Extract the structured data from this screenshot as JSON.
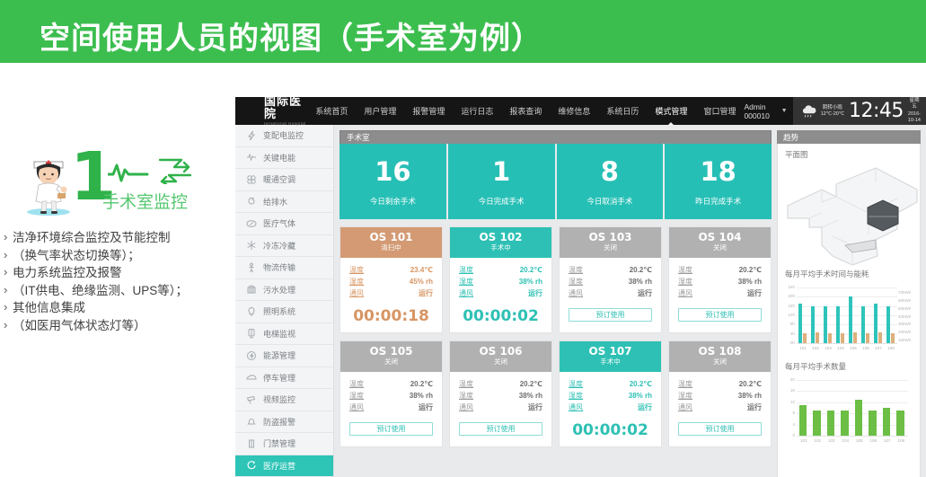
{
  "slide": {
    "title": "空间使用人员的视图（手术室为例）",
    "banner_color": "#3cbe4f",
    "number": "1",
    "subject_label": "手术室监控",
    "bullets": [
      "洁净环境综合监控及节能控制",
      "（换气率状态切换等）；",
      "电力系统监控及报警",
      "（IT供电、绝缘监测、UPS等）；",
      "其他信息集成",
      "（如医用气体状态灯等）"
    ]
  },
  "app": {
    "brand_cn": "国际医院",
    "brand_en": "Iernational Hospital",
    "nav": [
      {
        "label": "系统首页",
        "active": false
      },
      {
        "label": "用户管理",
        "active": false
      },
      {
        "label": "报警管理",
        "active": false
      },
      {
        "label": "运行日志",
        "active": false
      },
      {
        "label": "报表查询",
        "active": false
      },
      {
        "label": "维修信息",
        "active": false
      },
      {
        "label": "系统日历",
        "active": false
      },
      {
        "label": "模式管理",
        "active": true
      },
      {
        "label": "窗口管理",
        "active": false
      }
    ],
    "admin": "Admin 000010",
    "weather": {
      "condition": "阴转小雨",
      "temperature": "12℃-20℃",
      "icon": "cloud-rain-icon"
    },
    "clock": "12:45",
    "weekday": "星期五",
    "date": "2016-10-14",
    "sidebar": [
      {
        "label": "变配电监控",
        "icon": "bolt-icon",
        "active": false
      },
      {
        "label": "关键电能",
        "icon": "waveform-icon",
        "active": false
      },
      {
        "label": "暖通空调",
        "icon": "fan-icon",
        "active": false
      },
      {
        "label": "给排水",
        "icon": "water-drop-icon",
        "active": false
      },
      {
        "label": "医疗气体",
        "icon": "gas-icon",
        "active": false
      },
      {
        "label": "冷冻冷藏",
        "icon": "snowflake-icon",
        "active": false
      },
      {
        "label": "物流传输",
        "icon": "logistics-icon",
        "active": false
      },
      {
        "label": "污水处理",
        "icon": "sewage-icon",
        "active": false
      },
      {
        "label": "照明系统",
        "icon": "bulb-icon",
        "active": false
      },
      {
        "label": "电梯监视",
        "icon": "elevator-icon",
        "active": false
      },
      {
        "label": "能源管理",
        "icon": "energy-icon",
        "active": false
      },
      {
        "label": "停车管理",
        "icon": "car-icon",
        "active": false
      },
      {
        "label": "视频监控",
        "icon": "camera-icon",
        "active": false
      },
      {
        "label": "防盗报警",
        "icon": "bell-icon",
        "active": false
      },
      {
        "label": "门禁管理",
        "icon": "door-icon",
        "active": false
      },
      {
        "label": "医疗运营",
        "icon": "operations-icon",
        "active": true
      }
    ],
    "main": {
      "panel_title": "手术室",
      "kpis": [
        {
          "value": "16",
          "label": "今日剩余手术"
        },
        {
          "value": "1",
          "label": "今日完成手术"
        },
        {
          "value": "8",
          "label": "今日取消手术"
        },
        {
          "value": "18",
          "label": "昨日完成手术"
        }
      ],
      "row_labels": {
        "temp": "温度",
        "humidity": "湿度",
        "vent": "通风"
      },
      "book_label": "预订使用",
      "rooms": [
        {
          "name": "OS 101",
          "state": "清扫中",
          "state_type": "cleaning",
          "temp": "23.4℃",
          "humidity": "45% rh",
          "vent": "运行",
          "timer": "00:00:18",
          "has_timer": true
        },
        {
          "name": "OS 102",
          "state": "手术中",
          "state_type": "surgery",
          "temp": "20.2℃",
          "humidity": "38% rh",
          "vent": "运行",
          "timer": "00:00:02",
          "has_timer": true
        },
        {
          "name": "OS 103",
          "state": "关闭",
          "state_type": "closed",
          "temp": "20.2℃",
          "humidity": "38% rh",
          "vent": "运行",
          "timer": "",
          "has_timer": false
        },
        {
          "name": "OS 104",
          "state": "关闭",
          "state_type": "closed",
          "temp": "20.2℃",
          "humidity": "38% rh",
          "vent": "运行",
          "timer": "",
          "has_timer": false
        },
        {
          "name": "OS 105",
          "state": "关闭",
          "state_type": "closed",
          "temp": "20.2℃",
          "humidity": "38% rh",
          "vent": "运行",
          "timer": "",
          "has_timer": false
        },
        {
          "name": "OS 106",
          "state": "关闭",
          "state_type": "closed",
          "temp": "20.2℃",
          "humidity": "38% rh",
          "vent": "运行",
          "timer": "",
          "has_timer": false
        },
        {
          "name": "OS 107",
          "state": "手术中",
          "state_type": "surgery",
          "temp": "20.2℃",
          "humidity": "38% rh",
          "vent": "运行",
          "timer": "00:00:02",
          "has_timer": true
        },
        {
          "name": "OS 108",
          "state": "关闭",
          "state_type": "closed",
          "temp": "20.2℃",
          "humidity": "38% rh",
          "vent": "运行",
          "timer": "",
          "has_timer": false
        }
      ]
    },
    "trend": {
      "panel_title": "趋势",
      "floorplan_title": "平面图",
      "chart1_title": "每月平均手术时间与能耗",
      "chart2_title": "每月平均手术数量"
    }
  },
  "chart_data": [
    {
      "type": "bar",
      "title": "每月平均手术时间与能耗",
      "categories": [
        "101",
        "102",
        "103",
        "104",
        "105",
        "106",
        "107",
        "108"
      ],
      "series": [
        {
          "name": "平均手术时间",
          "axis": "left",
          "color": "#2ec4bb",
          "values": [
            17,
            16,
            16,
            16,
            20,
            16,
            17,
            16
          ]
        },
        {
          "name": "能耗",
          "axis": "right",
          "color": "#dcb07c",
          "values": [
            12,
            14,
            12,
            12,
            14,
            12,
            14,
            12
          ]
        }
      ],
      "ylabel": "",
      "ylim": [
        0,
        24
      ],
      "yticks": [
        "0h",
        "4h",
        "8h",
        "12h",
        "16h",
        "20h",
        "24h"
      ],
      "y2lim": [
        0,
        70
      ],
      "y2ticks": [
        "10kWh",
        "20kWh",
        "30kWh",
        "40kWh",
        "50kWh",
        "60kWh",
        "70kWh"
      ],
      "grid": true,
      "legend": "none"
    },
    {
      "type": "bar",
      "title": "每月平均手术数量",
      "categories": [
        "101",
        "102",
        "103",
        "104",
        "105",
        "106",
        "107",
        "108"
      ],
      "values": [
        11,
        9,
        9,
        9,
        13,
        9,
        10,
        9
      ],
      "color": "#6cbe45",
      "ylim": [
        0,
        20
      ],
      "yticks": [
        "0",
        "4",
        "8",
        "12",
        "16",
        "20"
      ],
      "grid": true,
      "legend": "none"
    }
  ]
}
